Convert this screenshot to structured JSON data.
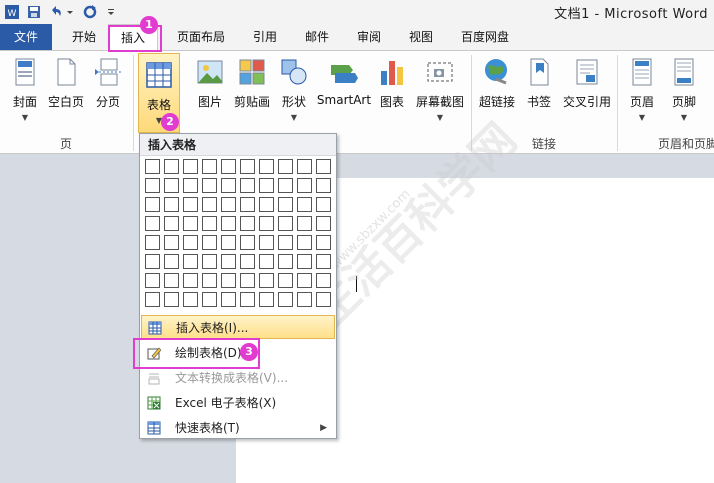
{
  "window": {
    "title": "文档1 - Microsoft Word"
  },
  "tabs": [
    {
      "label": "文件"
    },
    {
      "label": "开始"
    },
    {
      "label": "插入"
    },
    {
      "label": "页面布局"
    },
    {
      "label": "引用"
    },
    {
      "label": "邮件"
    },
    {
      "label": "审阅"
    },
    {
      "label": "视图"
    },
    {
      "label": "百度网盘"
    }
  ],
  "ribbon": {
    "buttons": [
      {
        "label": "封面"
      },
      {
        "label": "空白页"
      },
      {
        "label": "分页"
      },
      {
        "label": "表格"
      },
      {
        "label": "图片"
      },
      {
        "label": "剪贴画"
      },
      {
        "label": "形状"
      },
      {
        "label": "SmartArt"
      },
      {
        "label": "图表"
      },
      {
        "label": "屏幕截图"
      },
      {
        "label": "超链接"
      },
      {
        "label": "书签"
      },
      {
        "label": "交叉引用"
      },
      {
        "label": "页眉"
      },
      {
        "label": "页脚"
      }
    ],
    "groups": [
      {
        "label": "页"
      },
      {
        "label": "链接"
      },
      {
        "label": "页眉和页脚"
      }
    ]
  },
  "dropdown": {
    "header": "插入表格",
    "grid": {
      "cols": 10,
      "rows": 8
    },
    "items": [
      {
        "label": "插入表格(I)...",
        "disabled": false
      },
      {
        "label": "绘制表格(D)",
        "disabled": false
      },
      {
        "label": "文本转换成表格(V)...",
        "disabled": true
      },
      {
        "label": "Excel 电子表格(X)",
        "disabled": false
      },
      {
        "label": "快速表格(T)",
        "disabled": false
      }
    ]
  },
  "annotations": [
    {
      "num": "1"
    },
    {
      "num": "2"
    },
    {
      "num": "3"
    }
  ],
  "watermark": {
    "text": "生活百科学网",
    "url": "www.sbzxw.com"
  },
  "colors": {
    "file_tab": "#2b5aa6",
    "annotation": "#e23bd0",
    "menu_hover": "#ffe08a"
  }
}
